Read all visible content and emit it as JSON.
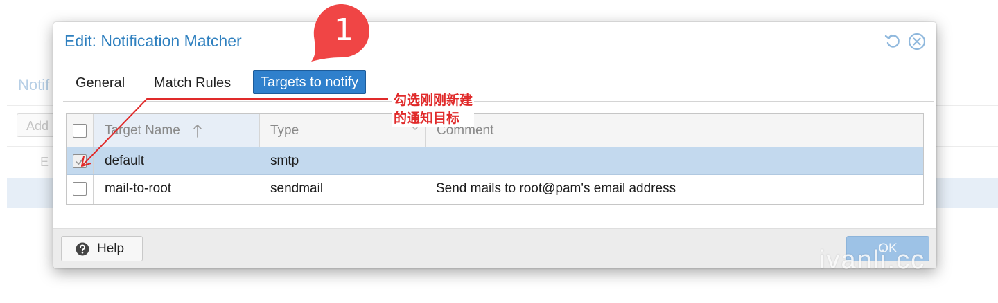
{
  "background": {
    "title": "Notif",
    "add_label": "Add",
    "column_label": "E"
  },
  "dialog": {
    "title": "Edit: Notification Matcher",
    "header_icons": [
      "reset-icon",
      "close-icon"
    ],
    "tabs": [
      {
        "label": "General",
        "active": false
      },
      {
        "label": "Match Rules",
        "active": false
      },
      {
        "label": "Targets to notify",
        "active": true
      }
    ],
    "grid": {
      "columns": [
        "Target Name",
        "Type",
        "Comment"
      ],
      "sort": {
        "column": "Target Name",
        "direction": "ascending",
        "icon": "sort-up-arrow-icon"
      },
      "rows": [
        {
          "name": "default",
          "type": "smtp",
          "comment": "",
          "checked": true,
          "selected": true
        },
        {
          "name": "mail-to-root",
          "type": "sendmail",
          "comment": "Send mails to root@pam's email address",
          "checked": false,
          "selected": false
        }
      ]
    },
    "footer": {
      "help_label": "Help",
      "ok_label": "OK"
    }
  },
  "annotation": {
    "badge_number": "1",
    "note": "勾选刚刚新建\n的通知目标",
    "color": "#e02a2a"
  },
  "watermark": "ivanli.cc",
  "colors": {
    "accent": "#2f80cc",
    "title": "#2f80bf",
    "selected_row": "#c3d9ee",
    "ok_button": "#9dc2e6"
  }
}
